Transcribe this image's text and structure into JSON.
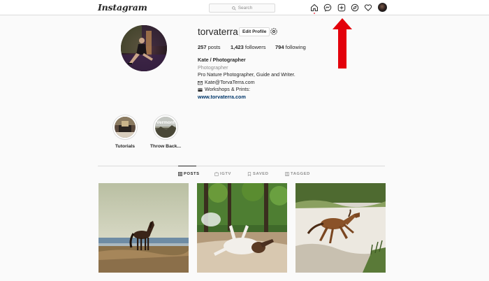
{
  "app": {
    "logo": "Instagram"
  },
  "search": {
    "placeholder": "Search"
  },
  "nav": {
    "icons": [
      "home-icon",
      "messenger-icon",
      "new-post-icon",
      "explore-icon",
      "activity-heart-icon",
      "profile-avatar"
    ]
  },
  "profile": {
    "username": "torvaterra",
    "edit_label": "Edit Profile",
    "stats": {
      "posts_count": "257",
      "posts_label": "posts",
      "followers_count": "1,423",
      "followers_label": "followers",
      "following_count": "794",
      "following_label": "following"
    },
    "bio": {
      "name": "Kate / Photographer",
      "category": "Photographer",
      "line1": "Pro Nature Photographer, Guide and Writer.",
      "email": "Kate@TorvaTerra.com",
      "workshops": "Workshops & Prints:",
      "website": "www.torvaterra.com"
    }
  },
  "highlights": [
    {
      "label": "Tutorials"
    },
    {
      "label": "Throw Back...",
      "cover_text": "Vermont"
    }
  ],
  "tabs": [
    {
      "label": "POSTS",
      "active": true,
      "icon": "grid-icon"
    },
    {
      "label": "IGTV",
      "active": false,
      "icon": "igtv-icon"
    },
    {
      "label": "SAVED",
      "active": false,
      "icon": "bookmark-icon"
    },
    {
      "label": "TAGGED",
      "active": false,
      "icon": "tag-icon"
    }
  ],
  "posts": [
    {
      "subject": "horse standing on beach"
    },
    {
      "subject": "white horse rolling in sand"
    },
    {
      "subject": "horse running on sand"
    }
  ],
  "colors": {
    "accent_red": "#ed4956",
    "link": "#00376b",
    "muted": "#8e8e8e",
    "border": "#dbdbdb",
    "annotation_arrow": "#e3000b"
  }
}
